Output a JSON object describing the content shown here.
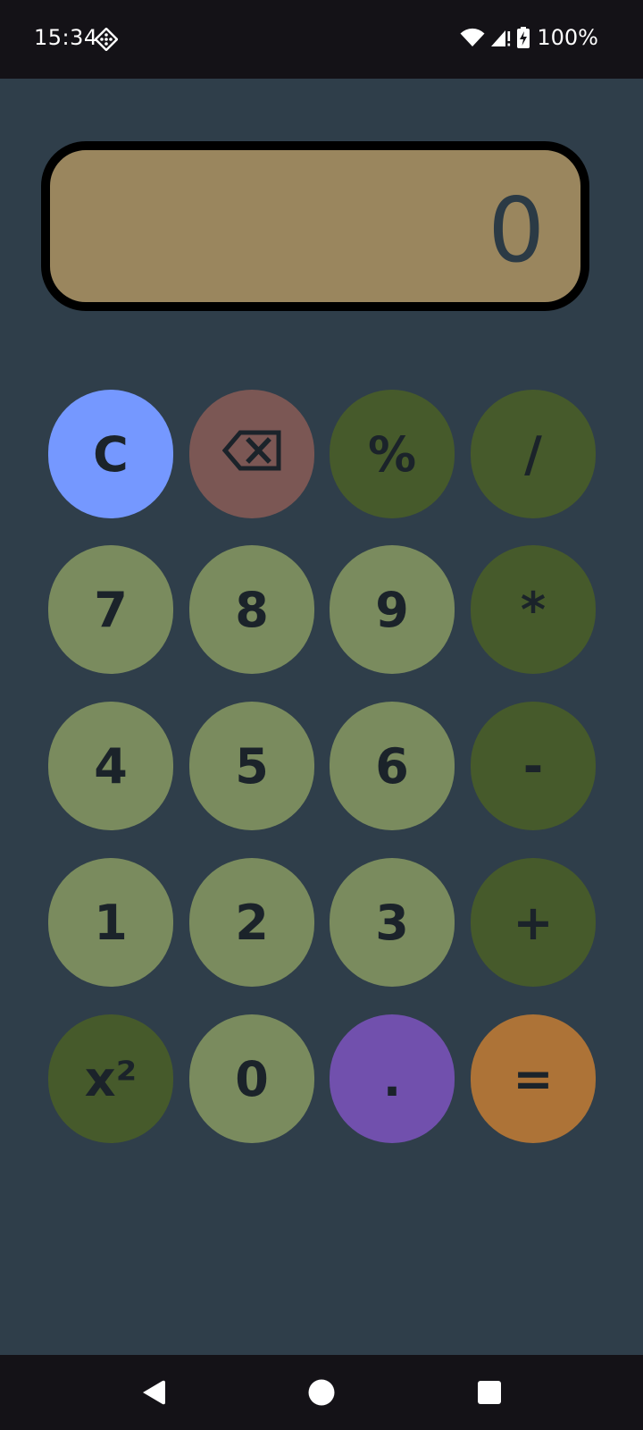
{
  "status_bar": {
    "time": "15:34",
    "app_icon": "dice-diamond-icon",
    "wifi_icon": "wifi-icon",
    "signal_icon": "cell-signal-no-service-icon",
    "battery_icon": "battery-charging-icon",
    "battery_text": "100%"
  },
  "display": {
    "value": "0",
    "colors": {
      "background": "#9a865e",
      "border": "#000000",
      "text": "#2b3a45"
    }
  },
  "keys": {
    "clear": "C",
    "backspace_icon": "backspace-icon",
    "percent": "%",
    "divide": "/",
    "seven": "7",
    "eight": "8",
    "nine": "9",
    "multiply": "*",
    "four": "4",
    "five": "5",
    "six": "6",
    "subtract": "-",
    "one": "1",
    "two": "2",
    "three": "3",
    "add": "+",
    "square": "x²",
    "zero": "0",
    "decimal": ".",
    "equals": "="
  },
  "colors": {
    "app_background": "#2f3e4a",
    "clear_key": "#7598ff",
    "backspace_key": "#7b5754",
    "operator_key": "#465a2b",
    "number_key": "#7a8b5e",
    "decimal_key": "#7150ad",
    "equals_key": "#ad7337",
    "key_text": "#1b232a"
  },
  "nav_bar": {
    "back_icon": "back-triangle-icon",
    "home_icon": "home-circle-icon",
    "recents_icon": "recents-square-icon"
  }
}
